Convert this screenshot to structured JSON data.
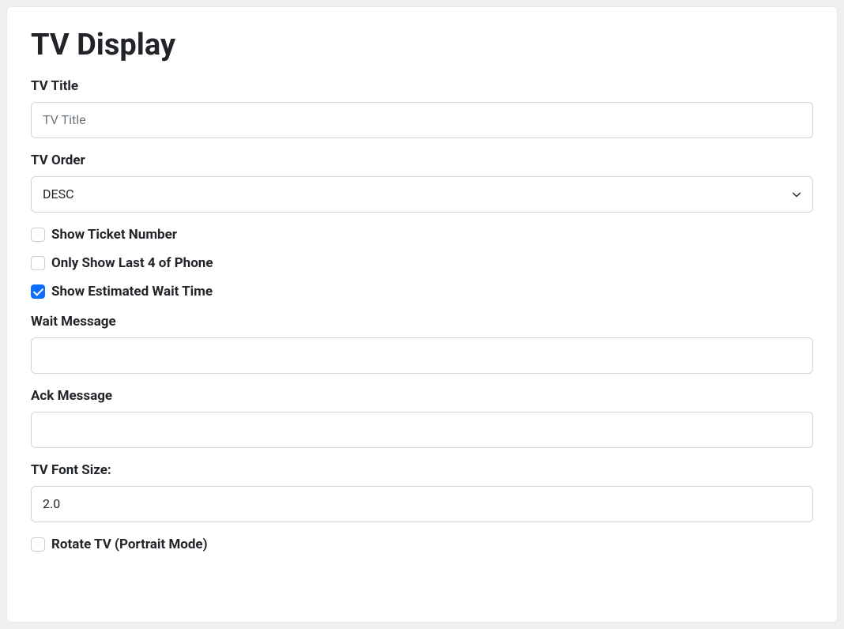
{
  "form": {
    "title": "TV Display",
    "tvTitle": {
      "label": "TV Title",
      "placeholder": "TV Title",
      "value": ""
    },
    "tvOrder": {
      "label": "TV Order",
      "selected": "DESC"
    },
    "checks": {
      "showTicketNumber": {
        "label": "Show Ticket Number",
        "checked": false
      },
      "onlyLast4": {
        "label": "Only Show Last 4 of Phone",
        "checked": false
      },
      "showEstWait": {
        "label": "Show Estimated Wait Time",
        "checked": true
      }
    },
    "waitMessage": {
      "label": "Wait Message",
      "value": ""
    },
    "ackMessage": {
      "label": "Ack Message",
      "value": ""
    },
    "tvFontSize": {
      "label": "TV Font Size:",
      "value": "2.0"
    },
    "rotateTv": {
      "label": "Rotate TV (Portrait Mode)",
      "checked": false
    }
  }
}
